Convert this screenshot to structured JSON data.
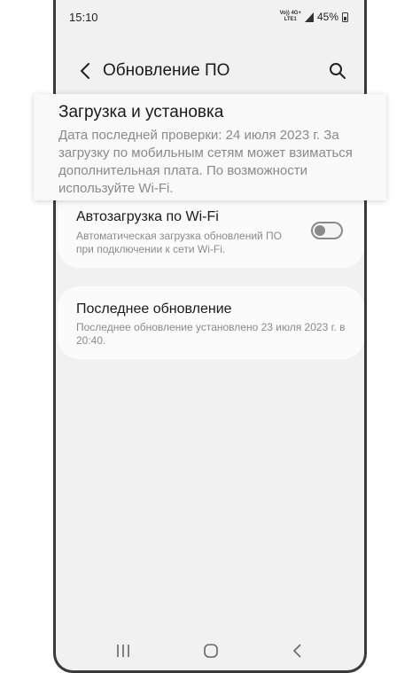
{
  "status_bar": {
    "time": "15:10",
    "network_top": "Vo)) 4G+",
    "network_bottom": "LTE1",
    "battery": "45%"
  },
  "header": {
    "title": "Обновление ПО"
  },
  "download_install": {
    "title": "Загрузка и установка",
    "description": "Дата последней проверки: 24 июля 2023 г. За загрузку по мобильным сетям может взиматься дополнительная плата. По возможности используйте Wi-Fi."
  },
  "auto_download": {
    "title": "Автозагрузка по Wi-Fi",
    "subtitle": "Автоматическая загрузка обновлений ПО при подключении к сети Wi-Fi.",
    "enabled": false
  },
  "last_update": {
    "title": "Последнее обновление",
    "subtitle": "Последнее обновление установлено 23 июля 2023 г. в 20:40."
  },
  "nav_icons": [
    "recent-apps-icon",
    "home-icon",
    "back-icon"
  ]
}
